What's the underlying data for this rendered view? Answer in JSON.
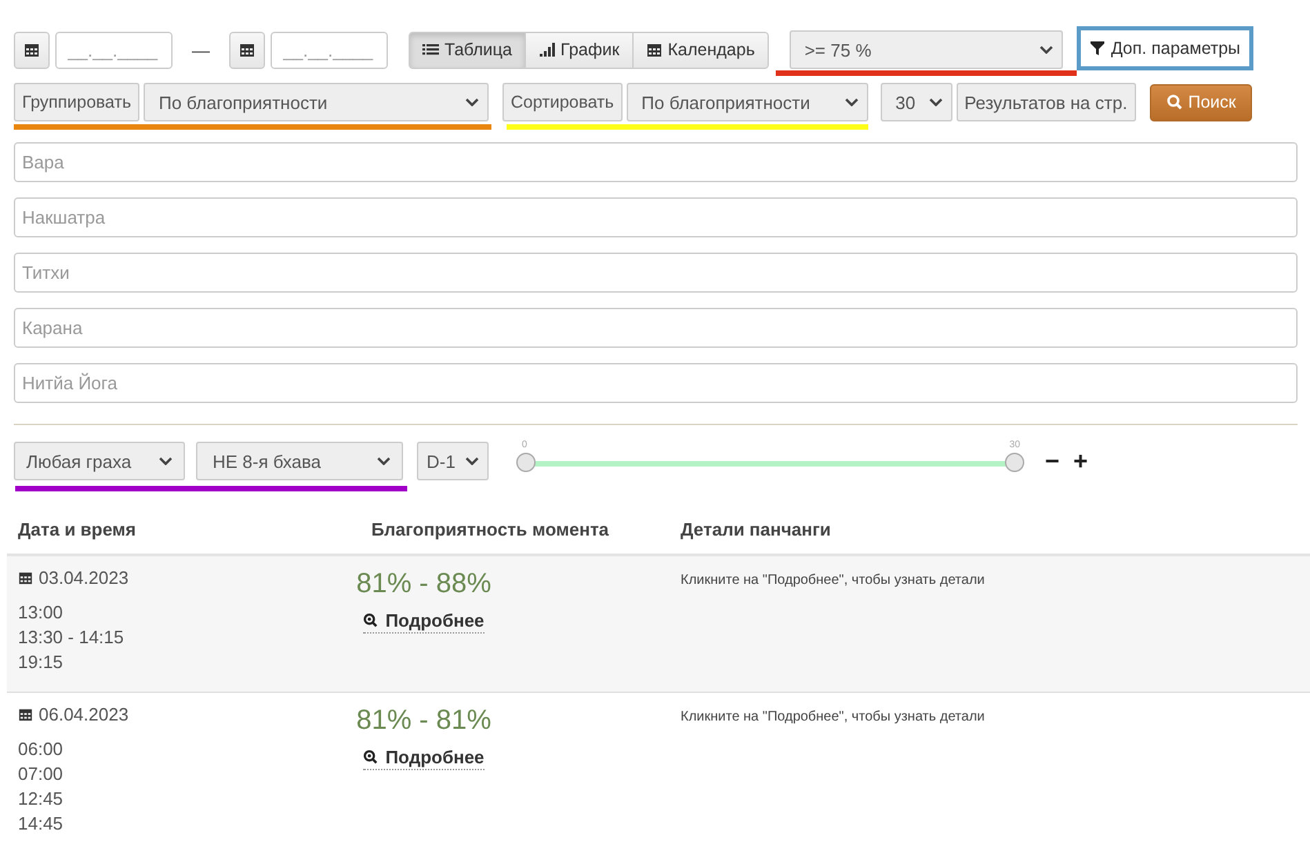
{
  "date_range": {
    "from_placeholder": "__.__.____",
    "separator": "—",
    "to_placeholder": "__.__.____"
  },
  "view_tabs": [
    {
      "label": "Таблица",
      "kind": "list",
      "selected": true
    },
    {
      "label": "График",
      "kind": "bars",
      "selected": false
    },
    {
      "label": "Календарь",
      "kind": "calendar",
      "selected": false
    }
  ],
  "threshold": {
    "value": ">= 75 %",
    "color": "#e0321a"
  },
  "more_params": {
    "label": "Доп. параметры",
    "color": "#5b9bc8"
  },
  "group": {
    "label": "Группировать",
    "value": "По благоприятности",
    "color": "#e8860f"
  },
  "sort": {
    "label": "Сортировать",
    "value": "По благоприятности",
    "color": "#ffff1a"
  },
  "per_page": {
    "value": "30",
    "label": "Результатов на стр."
  },
  "search_button": "Поиск",
  "text_filters": [
    {
      "placeholder": "Вара"
    },
    {
      "placeholder": "Накшатра"
    },
    {
      "placeholder": "Титхи"
    },
    {
      "placeholder": "Карана"
    },
    {
      "placeholder": "Нитйа Йога"
    }
  ],
  "graha_filters": {
    "selects": [
      "Любая граха",
      "НЕ 8-я бхава"
    ],
    "color": "#a000c8"
  },
  "chart_select": "D-1",
  "range_slider": {
    "min_label": "0",
    "max_label": "30",
    "level": 1
  },
  "step_buttons": [
    "−",
    "+"
  ],
  "table": {
    "columns": [
      "Дата и время",
      "Благоприятность момента",
      "Детали панчанги"
    ],
    "rows": [
      {
        "date": "03.04.2023",
        "times": [
          "13:00",
          "13:30 - 14:15",
          "19:15"
        ],
        "favour": "81% - 88%",
        "link": "Подробнее",
        "details": "Кликните на \"Подробнее\", чтобы узнать детали"
      },
      {
        "date": "06.04.2023",
        "times": [
          "06:00",
          "07:00",
          "12:45",
          "14:45"
        ],
        "favour": "81% - 81%",
        "link": "Подробнее",
        "details": "Кликните на \"Подробнее\", чтобы узнать детали"
      }
    ]
  }
}
